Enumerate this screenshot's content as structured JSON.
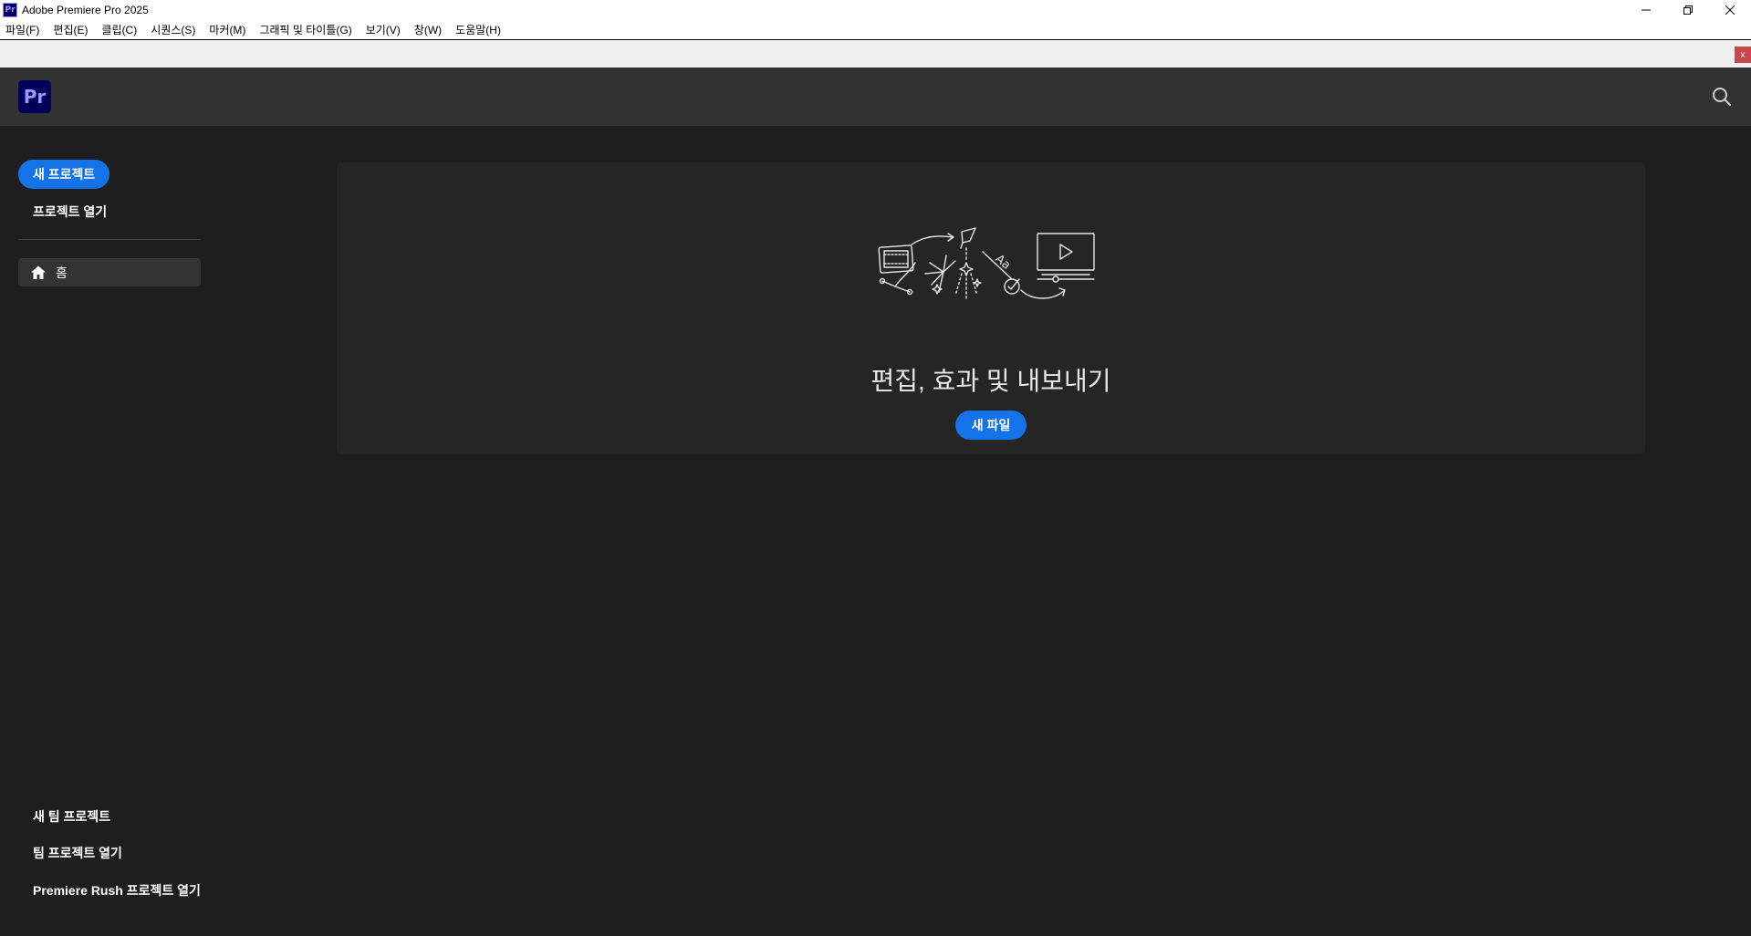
{
  "window": {
    "app_icon_text": "Pr",
    "title": "Adobe Premiere Pro 2025",
    "controls": [
      "minimize-icon",
      "restore-icon",
      "close-icon"
    ]
  },
  "menubar": {
    "items": [
      "파일(F)",
      "편집(E)",
      "클립(C)",
      "시퀀스(S)",
      "마커(M)",
      "그래픽 및 타이틀(G)",
      "보기(V)",
      "창(W)",
      "도움말(H)"
    ]
  },
  "notification": {
    "close_label": "x"
  },
  "header": {
    "logo_text": "Pr",
    "search_icon": "search-icon"
  },
  "sidebar": {
    "new_project": "새 프로젝트",
    "open_project": "프로젝트 열기",
    "nav": [
      {
        "label": "홈",
        "icon": "home-icon"
      }
    ],
    "bottom": {
      "new_team_project": "새 팀 프로젝트",
      "open_team_project": "팀 프로젝트 열기",
      "open_rush_project": "Premiere Rush 프로젝트 열기"
    }
  },
  "hero": {
    "title": "편집, 효과 및 내보내기",
    "new_file": "새 파일"
  },
  "colors": {
    "accent": "#1473e6",
    "background": "#1e1e1e",
    "header": "#323232",
    "card": "#252525",
    "logo_bg": "#00005b",
    "logo_fg": "#9999ff"
  }
}
